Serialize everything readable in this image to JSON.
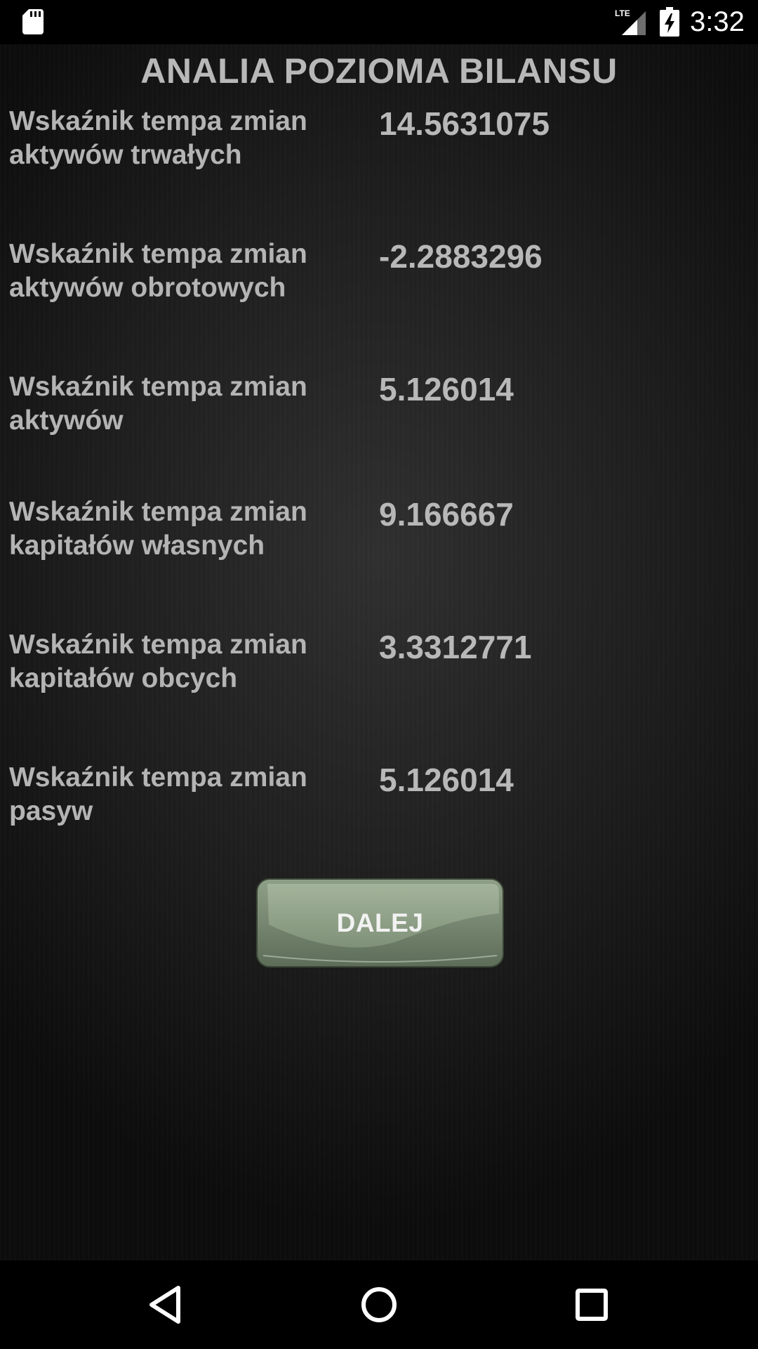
{
  "status_bar": {
    "time": "3:32",
    "network": "LTE",
    "icons": [
      "sd-card-icon",
      "lte-signal-icon",
      "battery-charging-icon"
    ]
  },
  "header": {
    "title": "ANALIA POZIOMA BILANSU"
  },
  "rows": [
    {
      "label": "Wskaźnik tempa zmian aktywów trwałych",
      "value": "14.5631075"
    },
    {
      "label": "Wskaźnik tempa zmian aktywów obrotowych",
      "value": "-2.2883296"
    },
    {
      "label": "Wskaźnik tempa zmian aktywów",
      "value": "5.126014"
    },
    {
      "label": "Wskaźnik tempa zmian kapitałów własnych",
      "value": "9.166667"
    },
    {
      "label": "Wskaźnik tempa zmian kapitałów obcych",
      "value": "3.3312771"
    },
    {
      "label": "Wskaźnik tempa zmian pasyw",
      "value": "5.126014"
    }
  ],
  "actions": {
    "next_label": "DALEJ"
  },
  "nav_bar": {
    "icons": [
      "back-icon",
      "home-icon",
      "recents-icon"
    ]
  },
  "colors": {
    "background": "#1e1e1e",
    "text": "#b8b8b8",
    "button_green": "#7c8f76"
  }
}
